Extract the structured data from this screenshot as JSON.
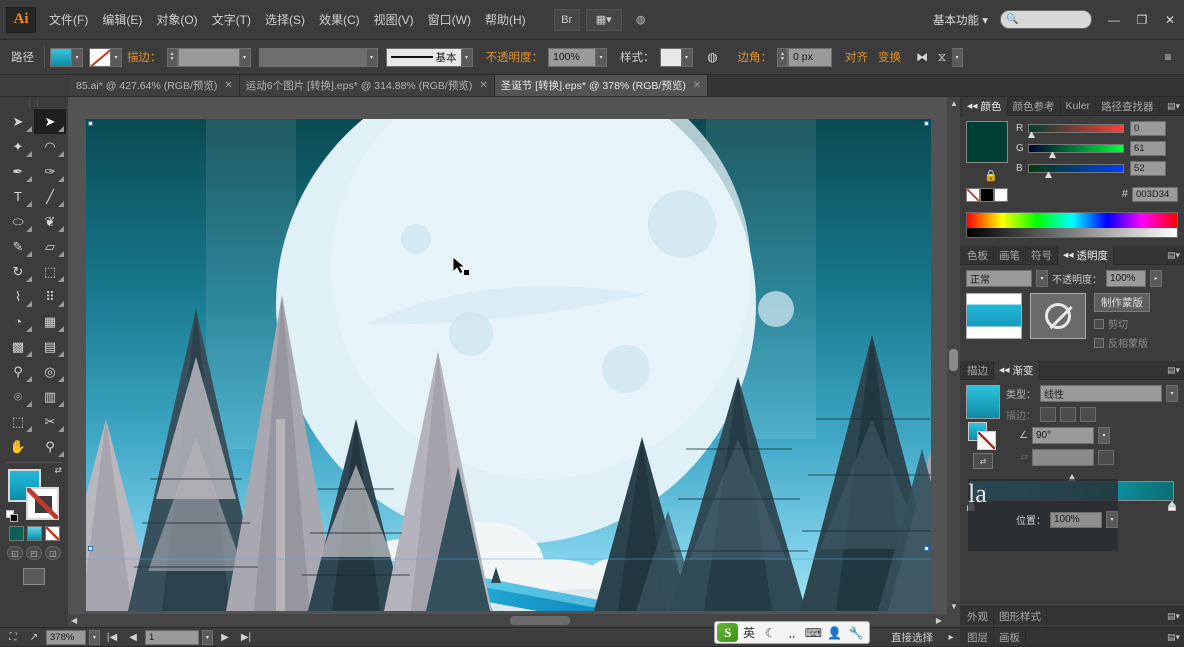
{
  "app": {
    "name": "Ai",
    "logo_text": "Ai"
  },
  "menubar": {
    "items": [
      {
        "label": "文件(F)"
      },
      {
        "label": "编辑(E)"
      },
      {
        "label": "对象(O)"
      },
      {
        "label": "文字(T)"
      },
      {
        "label": "选择(S)"
      },
      {
        "label": "效果(C)"
      },
      {
        "label": "视图(V)"
      },
      {
        "label": "窗口(W)"
      },
      {
        "label": "帮助(H)"
      }
    ],
    "bridge_icon": "br-icon",
    "arrange_label": "▦▾",
    "stock_icon": "stock-icon",
    "workspace": "基本功能 ▾",
    "search_placeholder": "",
    "minimize": "—",
    "restore": "❐",
    "close": "✕"
  },
  "controlbar": {
    "selection_label": "路径",
    "fill_swatch": "fill-swatch",
    "stroke_swatch": "stroke-swatch",
    "stroke_label": "描边：",
    "stroke_weight": "",
    "stroke_profile": "",
    "brush_label": "",
    "brush_value": "基本",
    "opacity_label": "不透明度：",
    "opacity_value": "100%",
    "style_label": "样式：",
    "style_swatch": "style-swatch",
    "recolor_icon": "recolor-artwork-icon",
    "corner_label": "边角：",
    "corner_value": "0 px",
    "align_label": "对齐",
    "transform_label": "变换",
    "isolate_icon": "isolate-icon",
    "mask_icon": "mask-icon",
    "panel_menu_icon": "panel-menu-icon"
  },
  "doctabs": [
    {
      "label": "85.ai* @ 427.64% (RGB/预览)",
      "close": "✕",
      "active": false
    },
    {
      "label": "运动6个图片 [转换].eps* @ 314.88% (RGB/预览)",
      "close": "✕",
      "active": false
    },
    {
      "label": "圣诞节 [转换].eps* @ 378% (RGB/预览)",
      "close": "✕",
      "active": true
    }
  ],
  "toolbar": {
    "handle": "⋮⋮",
    "tools": [
      {
        "name": "selection-tool",
        "glyph": "➤",
        "selected": false
      },
      {
        "name": "direct-selection-tool",
        "glyph": "➤",
        "selected": true
      },
      {
        "name": "magic-wand-tool",
        "glyph": "✦",
        "selected": false
      },
      {
        "name": "lasso-tool",
        "glyph": "◠",
        "selected": false
      },
      {
        "name": "pen-tool",
        "glyph": "✒",
        "selected": false
      },
      {
        "name": "curvature-tool",
        "glyph": "✑",
        "selected": false
      },
      {
        "name": "type-tool",
        "glyph": "T",
        "selected": false
      },
      {
        "name": "line-segment-tool",
        "glyph": "╱",
        "selected": false
      },
      {
        "name": "ellipse-tool",
        "glyph": "⬭",
        "selected": false
      },
      {
        "name": "paintbrush-tool",
        "glyph": "🖌",
        "selected": false
      },
      {
        "name": "pencil-tool",
        "glyph": "✎",
        "selected": false
      },
      {
        "name": "eraser-tool",
        "glyph": "▱",
        "selected": false
      },
      {
        "name": "rotate-tool",
        "glyph": "↻",
        "selected": false
      },
      {
        "name": "scale-tool",
        "glyph": "⬚",
        "selected": false
      },
      {
        "name": "width-tool",
        "glyph": "⌇",
        "selected": false
      },
      {
        "name": "free-transform-tool",
        "glyph": "⠿",
        "selected": false
      },
      {
        "name": "shape-builder-tool",
        "glyph": "◔",
        "selected": false
      },
      {
        "name": "perspective-grid-tool",
        "glyph": "▦",
        "selected": false
      },
      {
        "name": "mesh-tool",
        "glyph": "▩",
        "selected": false
      },
      {
        "name": "gradient-tool",
        "glyph": "▤",
        "selected": false
      },
      {
        "name": "eyedropper-tool",
        "glyph": "⚲",
        "selected": false
      },
      {
        "name": "blend-tool",
        "glyph": "◎",
        "selected": false
      },
      {
        "name": "symbol-sprayer-tool",
        "glyph": "⌾",
        "selected": false
      },
      {
        "name": "column-graph-tool",
        "glyph": "▥",
        "selected": false
      },
      {
        "name": "artboard-tool",
        "glyph": "⬚",
        "selected": false
      },
      {
        "name": "slice-tool",
        "glyph": "✂",
        "selected": false
      },
      {
        "name": "hand-tool",
        "glyph": "✋",
        "selected": false
      },
      {
        "name": "zoom-tool",
        "glyph": "⚲",
        "selected": false
      }
    ],
    "fill_label": "fill-swatch",
    "stroke_label": "stroke-swatch-none",
    "swap_icon": "swap-fill-stroke-icon",
    "default_icon": "default-fill-stroke-icon",
    "fill_modes": [
      "color-fill-mode",
      "gradient-fill-mode",
      "none-fill-mode"
    ],
    "screen_modes": [
      "normal-screen-mode",
      "fullscreen-menubar-mode",
      "fullscreen-mode"
    ],
    "change_screen": "change-screen-mode-icon"
  },
  "statusbar": {
    "fit_icon": "fit-artboard-icon",
    "share_icon": "share-icon",
    "zoom_value": "378%",
    "first_icon": "first-artboard-icon",
    "prev_icon": "prev-artboard-icon",
    "artboard_value": "1",
    "next_icon": "next-artboard-icon",
    "last_icon": "last-artboard-icon",
    "status_text": "直接选择",
    "expand_icon": "▸"
  },
  "ime": {
    "logo": "S",
    "mode": "英",
    "icons": [
      "moon-icon",
      "punctuation-icon",
      "keyboard-icon",
      "user-icon",
      "wrench-icon"
    ]
  },
  "panels": {
    "color": {
      "tabs": [
        {
          "label": "颜色",
          "active": true
        },
        {
          "label": "颜色参考",
          "active": false
        },
        {
          "label": "Kuler",
          "active": false
        },
        {
          "label": "路径查找器",
          "active": false
        }
      ],
      "menu": "▤▾",
      "swatch_hex": "#003d34",
      "lock_icon": "lock-icon",
      "channels": [
        {
          "label": "R",
          "value": "0",
          "knob_pct": 0
        },
        {
          "label": "G",
          "value": "61",
          "knob_pct": 24
        },
        {
          "label": "B",
          "value": "52",
          "knob_pct": 20
        }
      ],
      "hex_label": "#",
      "hex_value": "003D34",
      "none_swatch": "none-swatch",
      "black_swatch": "black-swatch",
      "white_swatch": "white-swatch"
    },
    "transparency": {
      "tabs": [
        {
          "label": "色板",
          "active": false
        },
        {
          "label": "画笔",
          "active": false
        },
        {
          "label": "符号",
          "active": false
        },
        {
          "label": "透明度",
          "active": true
        }
      ],
      "menu": "▤▾",
      "blend_mode": "正常",
      "opacity_label": "不透明度：",
      "opacity_value": "100%",
      "artwork_thumb": "artwork-thumbnail",
      "mask_thumb": "mask-thumbnail-none",
      "make_mask_label": "制作蒙版",
      "clip_label": "剪切",
      "invert_label": "反相蒙版"
    },
    "gradient": {
      "tabs": [
        {
          "label": "描边",
          "active": false
        },
        {
          "label": "渐变",
          "active": true
        }
      ],
      "menu": "▤▾",
      "preview": "gradient-preview",
      "type_label": "类型：",
      "type_value": "线性",
      "stroke_label": "描边：",
      "angle_label": "∠",
      "angle_value": "90°",
      "aspect_label": "▱",
      "aspect_value": "",
      "reverse_icon": "reverse-gradient-icon",
      "stops": [
        {
          "pos": 0,
          "color": "#2fc3e0"
        },
        {
          "pos": 100,
          "color": "#0a6f72"
        }
      ]
    },
    "overlay": {
      "fragment_a": "la",
      "fragment_b": "",
      "position_label": "位置：",
      "position_value": "100%"
    },
    "appearance": {
      "tabs": [
        {
          "label": "外观",
          "active": false
        },
        {
          "label": "图形样式",
          "active": false
        }
      ],
      "menu": "▤▾"
    },
    "layers": {
      "tabs": [
        {
          "label": "图层",
          "active": false
        },
        {
          "label": "画板",
          "active": false
        }
      ],
      "menu": "▤▾"
    }
  },
  "artwork": {
    "title": "winter-forest-moon-illustration",
    "colors": {
      "sky_top": "#0a4a52",
      "sky_mid": "#1b8aa0",
      "sky_bottom": "#7fd0ea",
      "moon": "#dff0f7",
      "tree_dark": "#2e4750",
      "tree_mid": "#456068",
      "tree_light": "#b9b7bd",
      "snow": "#f2f4f5",
      "river": "#1a9fcf"
    },
    "cursor": "direct-selection-cursor"
  }
}
